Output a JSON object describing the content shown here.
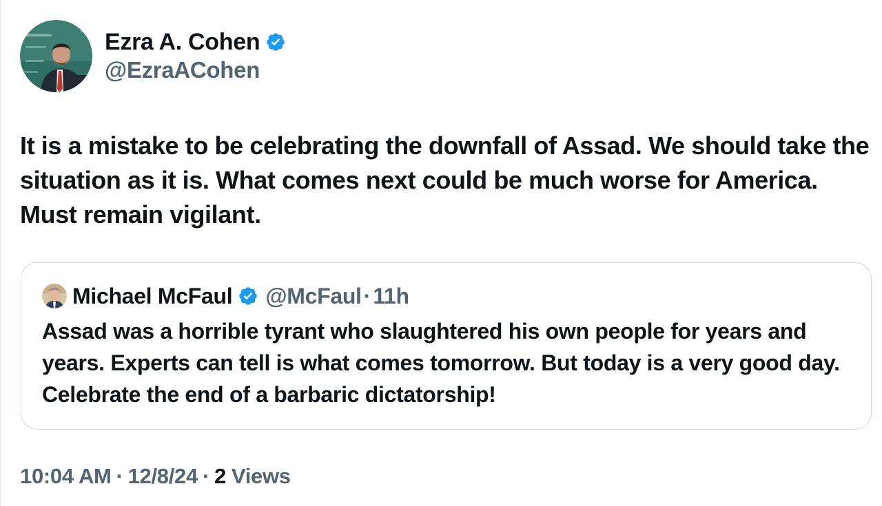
{
  "author": {
    "display_name": "Ezra A. Cohen",
    "handle": "@EzraACohen",
    "verified": true,
    "avatar_icon": "profile-photo"
  },
  "tweet": {
    "text": "It is a mistake to be celebrating the downfall of Assad. We should take the situation as it is. What comes next could be much worse for America. Must remain vigilant."
  },
  "quote": {
    "display_name": "Michael McFaul",
    "handle": "@McFaul",
    "separator": "·",
    "time_ago": "11h",
    "verified": true,
    "text": "Assad was a horrible tyrant who slaughtered his own people for years and years. Experts can tell is what comes tomorrow. But today is a very good day. Celebrate the end of a barbaric dictatorship!"
  },
  "meta": {
    "time": "10:04 AM",
    "separator": "·",
    "date": "12/8/24",
    "views_count": "2",
    "views_label": "Views"
  },
  "colors": {
    "verified_blue": "#1d9bf0",
    "text_primary": "#0f1419",
    "text_secondary": "#536471",
    "card_border": "#cfd9de"
  }
}
